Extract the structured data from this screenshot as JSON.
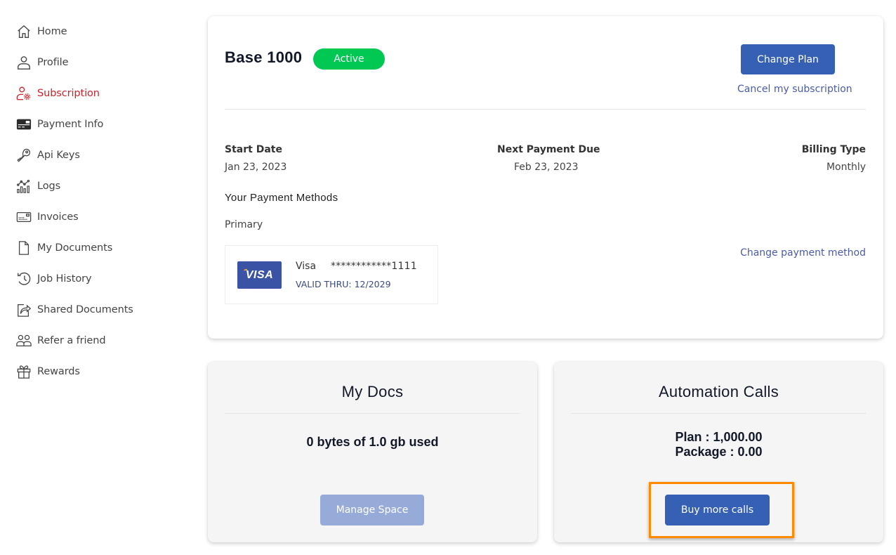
{
  "sidebar": {
    "items": [
      {
        "label": "Home",
        "icon": "home-icon",
        "active": false
      },
      {
        "label": "Profile",
        "icon": "user-icon",
        "active": false
      },
      {
        "label": "Subscription",
        "icon": "user-gear-icon",
        "active": true
      },
      {
        "label": "Payment Info",
        "icon": "credit-card-icon",
        "active": false
      },
      {
        "label": "Api Keys",
        "icon": "key-icon",
        "active": false
      },
      {
        "label": "Logs",
        "icon": "chart-icon",
        "active": false
      },
      {
        "label": "Invoices",
        "icon": "invoice-icon",
        "active": false
      },
      {
        "label": "My Documents",
        "icon": "document-icon",
        "active": false
      },
      {
        "label": "Job History",
        "icon": "history-icon",
        "active": false
      },
      {
        "label": "Shared Documents",
        "icon": "share-icon",
        "active": false
      },
      {
        "label": "Refer a friend",
        "icon": "users-icon",
        "active": false
      },
      {
        "label": "Rewards",
        "icon": "gift-icon",
        "active": false
      }
    ],
    "active_color": "#d0202a"
  },
  "subscription": {
    "plan_name": "Base 1000",
    "status": "Active",
    "status_color": "#00c853",
    "change_plan_label": "Change Plan",
    "cancel_label": "Cancel my subscription",
    "start_date_label": "Start Date",
    "start_date": "Jan 23, 2023",
    "next_payment_label": "Next Payment Due",
    "next_payment": "Feb 23, 2023",
    "billing_type_label": "Billing Type",
    "billing_type": "Monthly",
    "payment_methods_title": "Your Payment Methods",
    "primary_label": "Primary",
    "card": {
      "logo_text": "VISA",
      "brand": "Visa",
      "number": "************1111",
      "expiry": "VALID THRU: 12/2029"
    },
    "change_payment_label": "Change payment method"
  },
  "my_docs": {
    "title": "My Docs",
    "usage": "0 bytes of 1.0 gb used",
    "button_label": "Manage Space"
  },
  "automation_calls": {
    "title": "Automation Calls",
    "plan_line": "Plan : 1,000.00",
    "package_line": "Package : 0.00",
    "button_label": "Buy more calls",
    "highlight_color": "#ff8a00"
  },
  "colors": {
    "primary_button": "#3560b4",
    "disabled_button": "#97abd8",
    "link": "#4a5ba8"
  }
}
